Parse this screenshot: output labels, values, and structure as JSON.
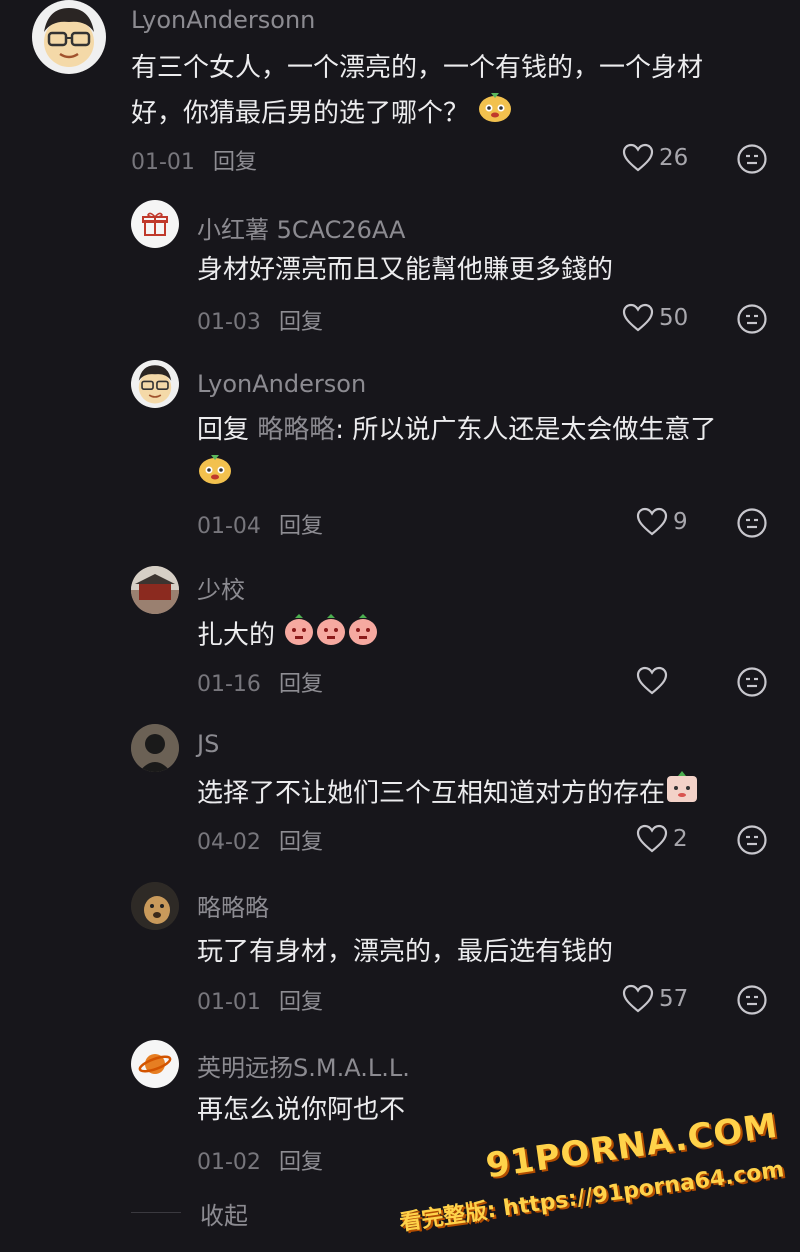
{
  "comments": [
    {
      "username": "LyonAndersonn",
      "line1": "有三个女人，一个漂亮的，一个有钱的，一个身材",
      "line2": "好，你猜最后男的选了哪个？",
      "date": "01-01",
      "reply": "回复",
      "likes": "26",
      "avatar_icon": "glasses-face-avatar",
      "emoji": "lion-face-emoji"
    },
    {
      "username": "小红薯 5CAC26AA",
      "text": "身材好漂亮而且又能幫他賺更多錢的",
      "date": "01-03",
      "reply": "回复",
      "likes": "50",
      "avatar_icon": "gift-avatar"
    },
    {
      "username": "LyonAnderson",
      "reply_prefix": "回复",
      "reply_target": "略略略",
      "text": ": 所以说广东人还是太会做生意了",
      "date": "01-04",
      "reply": "回复",
      "likes": "9",
      "avatar_icon": "glasses-face-avatar",
      "emoji": "lion-face-emoji"
    },
    {
      "username": "少校",
      "text": "扎大的",
      "date": "01-16",
      "reply": "回复",
      "likes": "",
      "avatar_icon": "building-photo-avatar",
      "emoji": "peach-face-emoji"
    },
    {
      "username": "JS",
      "text": "选择了不让她们三个互相知道对方的存在",
      "date": "04-02",
      "reply": "回复",
      "likes": "2",
      "avatar_icon": "dark-figure-avatar",
      "emoji": "shy-face-emoji"
    },
    {
      "username": "略略略",
      "text": "玩了有身材，漂亮的，最后选有钱的",
      "date": "01-01",
      "reply": "回复",
      "likes": "57",
      "avatar_icon": "dog-photo-avatar"
    },
    {
      "username": "英明远扬S.M.A.L.L.",
      "text": "再怎么说你阿也不",
      "date": "01-02",
      "reply": "回复",
      "likes": "",
      "avatar_icon": "planet-avatar"
    }
  ],
  "collapse_label": "收起",
  "watermark": {
    "logo": "91PORNA.COM",
    "url": "看完整版: https://91porna64.com"
  },
  "colors": {
    "background": "#17161b",
    "text": "#ececee",
    "muted": "#8c8b91",
    "watermark": "#ffd24a"
  }
}
